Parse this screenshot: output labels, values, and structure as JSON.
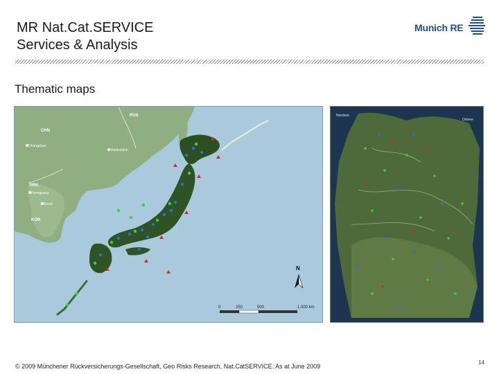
{
  "header": {
    "title_line1": "MR Nat.Cat.SERVICE",
    "title_line2": "Services & Analysis",
    "logo_text": "Munich RE"
  },
  "section": {
    "heading": "Thematic maps"
  },
  "japan_map": {
    "countries": [
      "CHN",
      "RUS",
      "PRK",
      "KOR"
    ],
    "cities": [
      "Changchun",
      "Vladivostok",
      "Pyongyang",
      "Seoul"
    ],
    "north_label": "N",
    "scale_ticks": [
      "0",
      "250",
      "500",
      "1.000 km"
    ]
  },
  "germany_map": {
    "sea_labels": [
      "Nordsee",
      "Ostsee"
    ]
  },
  "footer": {
    "copyright": "© 2009 Münchener Rückversicherungs-Gesellschaft, Geo Risks Research, Nat.CatSERVICE. As at June 2009",
    "page_number": "14"
  },
  "colors": {
    "accent_blue": "#1f4e8c",
    "sea": "#a9c9dc",
    "land": "#8fae82",
    "marker_red": "#e0202a",
    "marker_green": "#3fcf3f",
    "marker_blue": "#2f6fd0"
  }
}
